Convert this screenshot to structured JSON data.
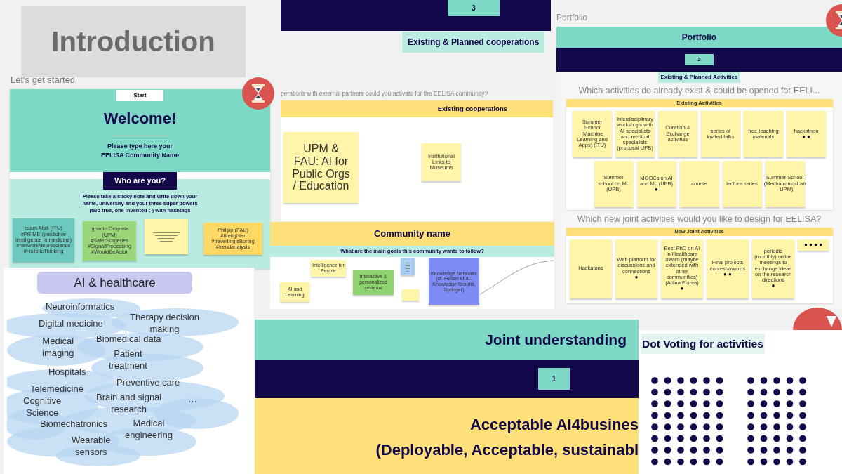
{
  "intro": {
    "title": "Introduction",
    "caption": "Let's get started"
  },
  "welcome": {
    "start": "Start",
    "title": "Welcome!",
    "prompt": "Please type here your\nEELISA Community Name",
    "who": "Who are you?",
    "instructions": "Please take a sticky note and write down your\nname, university and your three super powers\n(two true, one invented ;-) with hashtags",
    "notes": [
      {
        "kind": "note",
        "color": "#6cc9c0",
        "text": "Islam Abdi (ITU)\n#PRIME (predictive intelligence in medicine)\n#NetworkNeuroscience\n#HolisticThinking"
      },
      {
        "kind": "note",
        "color": "#9bd67a",
        "text": "Ignacio Oropesa (UPM)\n#SaferSurgeries\n#SignalProcessing\n#WouldBeActor"
      },
      {
        "kind": "scribble",
        "color": "#fff5a8"
      },
      {
        "kind": "note",
        "color": "#ffd866",
        "text": "Philipp (FAU)\n#firefighter\n#travellingisBoring\n#trendanalysis"
      }
    ]
  },
  "cooperations": {
    "step": "3",
    "chip": "Existing & Planned cooperations",
    "question": "perations with external partners could you activate for the EELISA community?",
    "header": "Existing cooperations",
    "notes": [
      {
        "text": "UPM &\nFAU: AI for\nPublic Orgs\n/ Education"
      },
      {
        "text": "Institutional\nLinks to\nMuseums"
      }
    ]
  },
  "community": {
    "title": "Community name",
    "subtitle": "What are the main goals this community wants to follow?",
    "notes": [
      {
        "kind": "note",
        "color": "#fff5a8",
        "text": "Intelligence for People"
      },
      {
        "kind": "note",
        "color": "#fff5a8",
        "text": "AI and Learning"
      },
      {
        "kind": "note",
        "color": "#8ed36f",
        "text": "Interactive & personalized systems"
      },
      {
        "kind": "scribble",
        "color": "#a9ccf5"
      },
      {
        "kind": "scribble",
        "color": "#fff5a8"
      },
      {
        "kind": "note",
        "color": "#7f8cf5",
        "text": "Knowledge Networks (cf. Fensel et al., Knowledge Graphs, Springer)"
      }
    ]
  },
  "portfolio": {
    "label": "Portfolio",
    "title": "Portfolio",
    "step": "2",
    "chip": "Existing & Planned Activities",
    "question_1": "Which activities do already exist & could be opened for EELI...",
    "existing": {
      "header": "Existing Activities",
      "notes": [
        {
          "text": "Summer School (Machine Learning and Apps) (ITU)"
        },
        {
          "text": "Interdisciplinary workshops with AI specialists and medical specialists (proposal UPB)"
        },
        {
          "text": "Curation & Exchange activities"
        },
        {
          "text": "series of invited talks"
        },
        {
          "text": "free teaching materials"
        },
        {
          "text": "hackathon",
          "dots": "● ●"
        },
        {
          "text": "Summer school on ML (UPB)"
        },
        {
          "text": "MOOCs on AI and ML (UPB)",
          "dots": "●"
        },
        {
          "text": "course"
        },
        {
          "text": "lecture series"
        },
        {
          "text": "Summer School (MechatronicsLab - UPM)"
        }
      ]
    },
    "question_2": "Which new joint activities would you like to design for EELISA?",
    "new": {
      "header": "New Joint Activities",
      "notes": [
        {
          "text": "Hackatons"
        },
        {
          "text": "Web platform for discussions and connections",
          "dots": "●"
        },
        {
          "text": "Best PhD on AI in Healthcare award (maybe extended with other communities) (Adina Florea)",
          "dots": "●"
        },
        {
          "text": "Final projects contest/awards",
          "dots": "● ●"
        },
        {
          "text": "periodic (monthly) online meetings to exchange ideas on the research directions",
          "dots": "●"
        },
        {
          "dots": "● ● ● ●"
        }
      ]
    }
  },
  "healthcare": {
    "title": "AI & healthcare",
    "topics": [
      "Neuroinformatics",
      "Digital medicine",
      "Therapy decision\nmaking",
      "Medical\nimaging",
      "Biomedical data",
      "Patient\ntreatment",
      "Hospitals",
      "Preventive care",
      "Telemedicine",
      "Cognitive\nScience",
      "Brain and signal\nresearch",
      "…",
      "Biomechatronics",
      "Medical\nengineering",
      "Wearable\nsensors"
    ]
  },
  "joint": {
    "title": "Joint understanding",
    "step": "1",
    "headline": "Acceptable AI4busines",
    "subline": "(Deployable, Acceptable, sustainabl"
  },
  "voting": {
    "title": "Dot Voting for activities"
  }
}
